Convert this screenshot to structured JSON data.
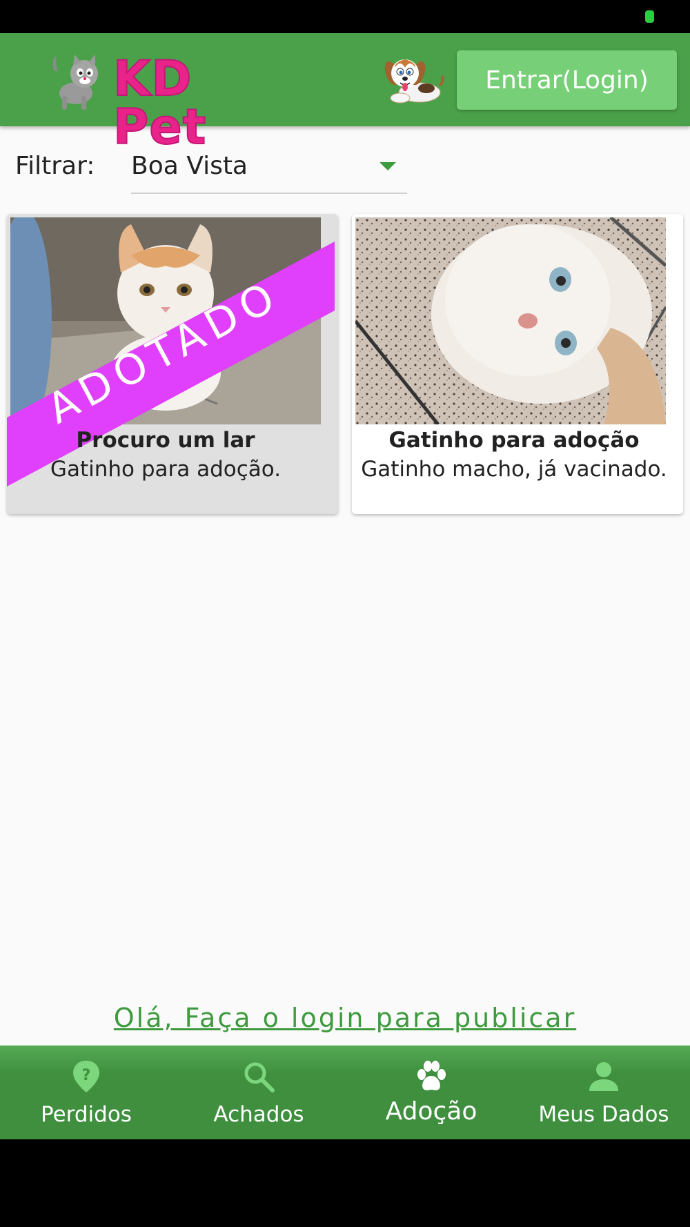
{
  "header": {
    "brand": "KD Pet",
    "login_label": "Entrar(Login)"
  },
  "filter": {
    "label": "Filtrar:",
    "selected": "Boa Vista"
  },
  "posts": [
    {
      "title": "Procuro um lar",
      "description": "Gatinho para adoção.",
      "ribbon": "ADOTADO"
    },
    {
      "title": "Gatinho para adoção",
      "description": "Gatinho macho, já vacinado."
    }
  ],
  "login_prompt": "Olá, Faça o login para publicar",
  "nav": {
    "items": [
      {
        "label": "Perdidos",
        "icon": "pin-question-icon"
      },
      {
        "label": "Achados",
        "icon": "search-icon"
      },
      {
        "label": "Adoção",
        "icon": "paw-icon",
        "active": true
      },
      {
        "label": "Meus Dados",
        "icon": "person-icon"
      }
    ]
  },
  "colors": {
    "primary": "#4aa14a",
    "button": "#77d077",
    "brand_pink": "#e9238a",
    "ribbon": "#e040fb",
    "nav_icon_inactive": "#7cd67c",
    "nav_icon_active": "#ffffff"
  }
}
